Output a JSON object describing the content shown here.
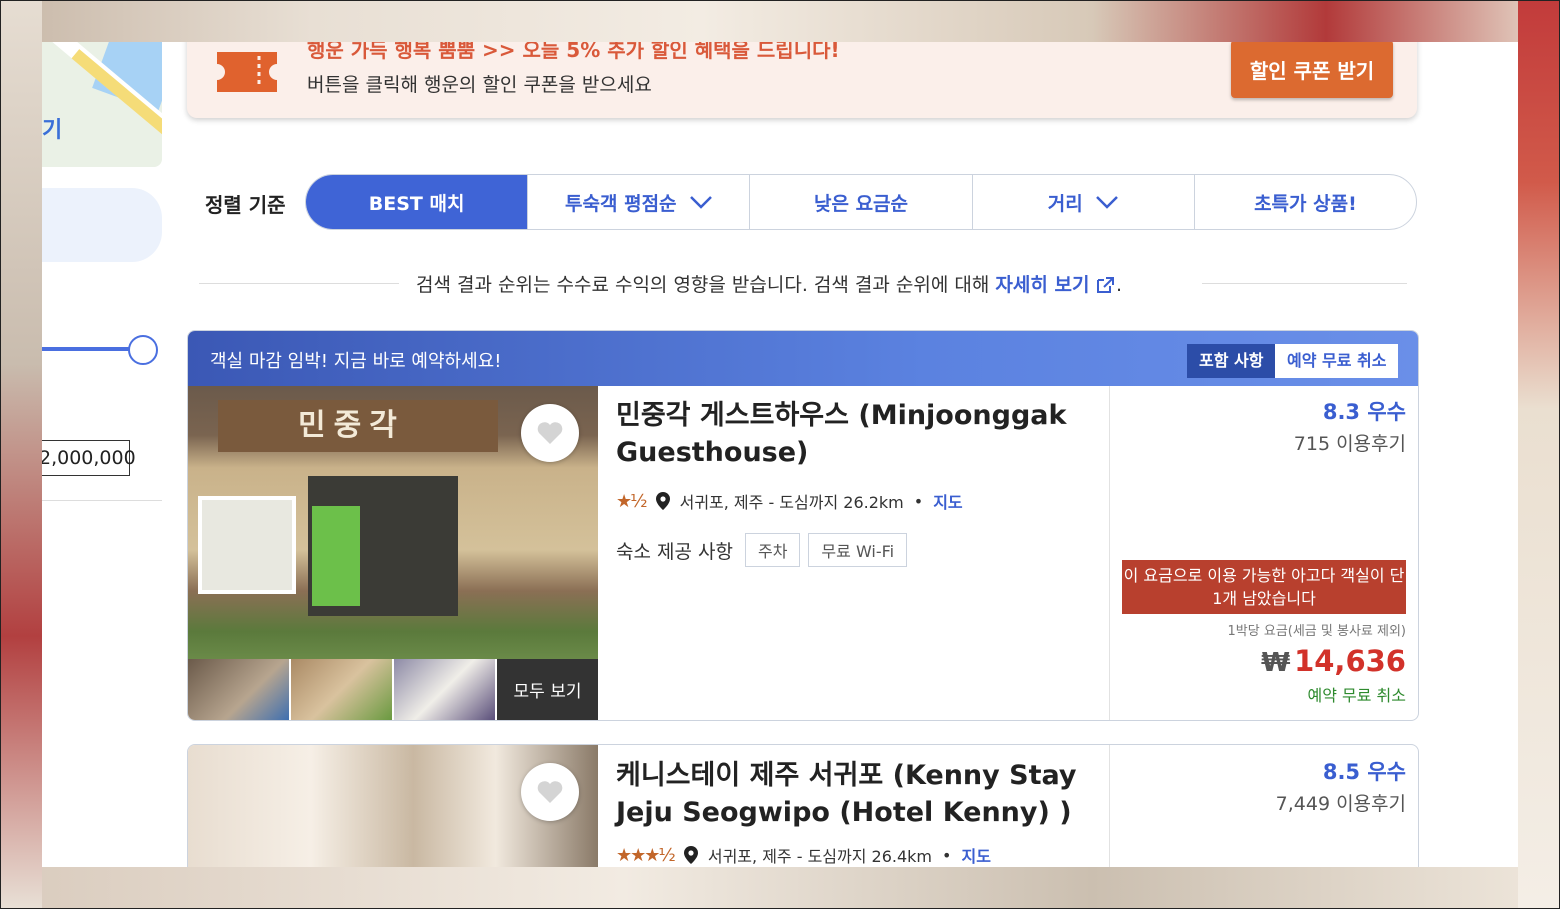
{
  "sidebar": {
    "map_label": "기",
    "price_value": "2,000,000"
  },
  "promo": {
    "headline": "행운 가득 행복 뿜뿜 >> 오늘 5% 추가 할인 혜택을 드립니다!",
    "subtext": "버튼을 클릭해 행운의 할인 쿠폰을 받으세요",
    "button_label": "할인 쿠폰 받기"
  },
  "sort": {
    "label": "정렬 기준",
    "tabs": [
      {
        "label": "BEST 매치"
      },
      {
        "label": "투숙객 평점순"
      },
      {
        "label": "낮은 요금순"
      },
      {
        "label": "거리"
      },
      {
        "label": "초특가 상품!"
      }
    ]
  },
  "disclosure": {
    "text": "검색 결과 순위는 수수료 수익의 영향을 받습니다. 검색 결과 순위에 대해",
    "link": "자세히 보기",
    "tail": "."
  },
  "listings": [
    {
      "banner": "객실 마감 임박! 지금 바로 예약하세요!",
      "included_label": "포함 사항",
      "included_value": "예약 무료 취소",
      "sign_text": "민중각",
      "view_all": "모두 보기",
      "title": "민중각 게스트하우스 (Minjoonggak Guesthouse)",
      "stars": "★½",
      "star_rating": 1.5,
      "location": "서귀포, 제주 - 도심까지 26.2km",
      "map_link": "지도",
      "amenities_label": "숙소 제공 사항",
      "amenities": [
        "주차",
        "무료 Wi-Fi"
      ],
      "score": "8.3 우수",
      "reviews": "715 이용후기",
      "urgent": "이 요금으로 이용 가능한 아고다 객실이 단 1개 남았습니다",
      "per_night": "1박당 요금(세금 및 봉사료 제외)",
      "currency": "₩",
      "price": "14,636",
      "free_cancel": "예약 무료 취소"
    },
    {
      "title": "케니스테이 제주 서귀포 (Kenny Stay Jeju Seogwipo (Hotel Kenny) )",
      "stars": "★★★½",
      "star_rating": 3.5,
      "location": "서귀포, 제주 - 도심까지 26.4km",
      "map_link": "지도",
      "score": "8.5 우수",
      "reviews": "7,449 이용후기"
    }
  ],
  "colors": {
    "accent": "#3f64d6",
    "promo_button": "#dc6a30",
    "urgent": "#b8402e",
    "price": "#d2322a",
    "free_cancel": "#2e8a2e"
  }
}
